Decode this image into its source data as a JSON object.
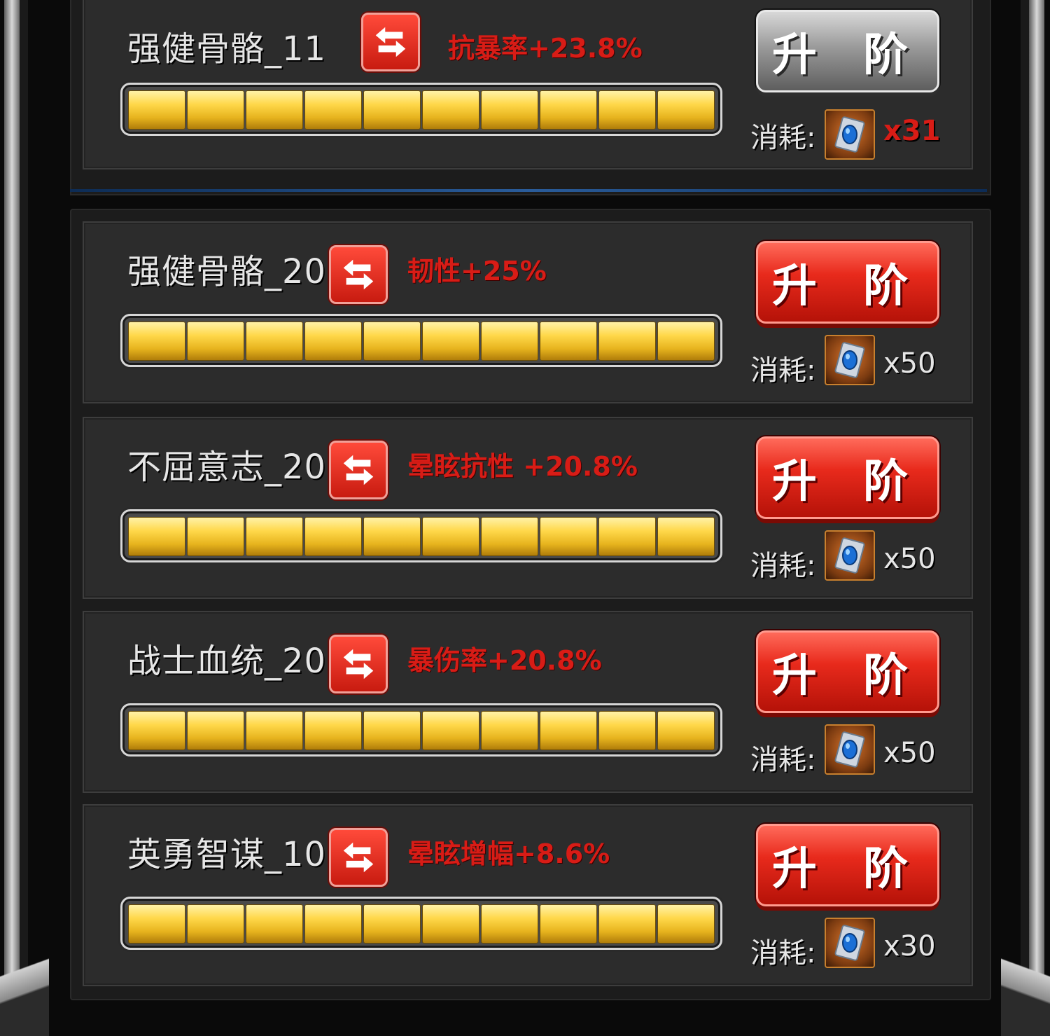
{
  "upgrade_label": "升 阶",
  "cost_label": "消耗:",
  "icons": {
    "swap": "swap-arrows-icon",
    "material": "upgrade-stone-icon"
  },
  "colors": {
    "stat_red": "#d81c16",
    "bar_gold": "#ffd84a",
    "button_red": "#e82a1c",
    "button_gray": "#9a9a9a"
  },
  "skills": [
    {
      "name": "强健骨骼_11",
      "stat": "抗暴率+23.8%",
      "progress_filled": 10,
      "progress_total": 10,
      "cost": "x31",
      "cost_insufficient": true,
      "button_enabled": false
    },
    {
      "name": "强健骨骼_20",
      "stat": "韧性+25%",
      "progress_filled": 10,
      "progress_total": 10,
      "cost": "x50",
      "cost_insufficient": false,
      "button_enabled": true
    },
    {
      "name": "不屈意志_20",
      "stat": "晕眩抗性 +20.8%",
      "progress_filled": 10,
      "progress_total": 10,
      "cost": "x50",
      "cost_insufficient": false,
      "button_enabled": true
    },
    {
      "name": "战士血统_20",
      "stat": "暴伤率+20.8%",
      "progress_filled": 10,
      "progress_total": 10,
      "cost": "x50",
      "cost_insufficient": false,
      "button_enabled": true
    },
    {
      "name": "英勇智谋_10",
      "stat": "晕眩增幅+8.6%",
      "progress_filled": 10,
      "progress_total": 10,
      "cost": "x30",
      "cost_insufficient": false,
      "button_enabled": true
    }
  ]
}
